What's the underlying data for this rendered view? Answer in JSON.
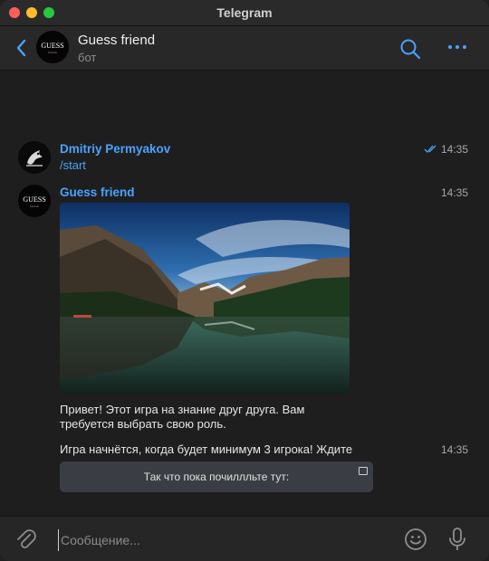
{
  "window": {
    "title": "Telegram"
  },
  "header": {
    "name": "Guess friend",
    "status": "бот",
    "avatar_text": "GUESS",
    "avatar_subtext": "friends"
  },
  "messages": [
    {
      "sender": "Dmitriy Permyakov",
      "text": "/start",
      "time": "14:35",
      "read": true
    },
    {
      "sender": "Guess friend",
      "time": "14:35",
      "photo": "mountain-lake-icon",
      "caption_line1": "Привет! Этот игра на знание друг друга. Вам",
      "caption_line2": "требуется выбрать свою роль.",
      "text": "Игра начнётся, когда будет минимум 3 игрока! Ждите",
      "text_time": "14:35",
      "keyboard_button": "Так что пока почиллльте тут:"
    }
  ],
  "composer": {
    "placeholder": "Сообщение..."
  },
  "colors": {
    "accent": "#4aa3ff",
    "background": "#1e1e1e",
    "button": "#3a3e44"
  }
}
